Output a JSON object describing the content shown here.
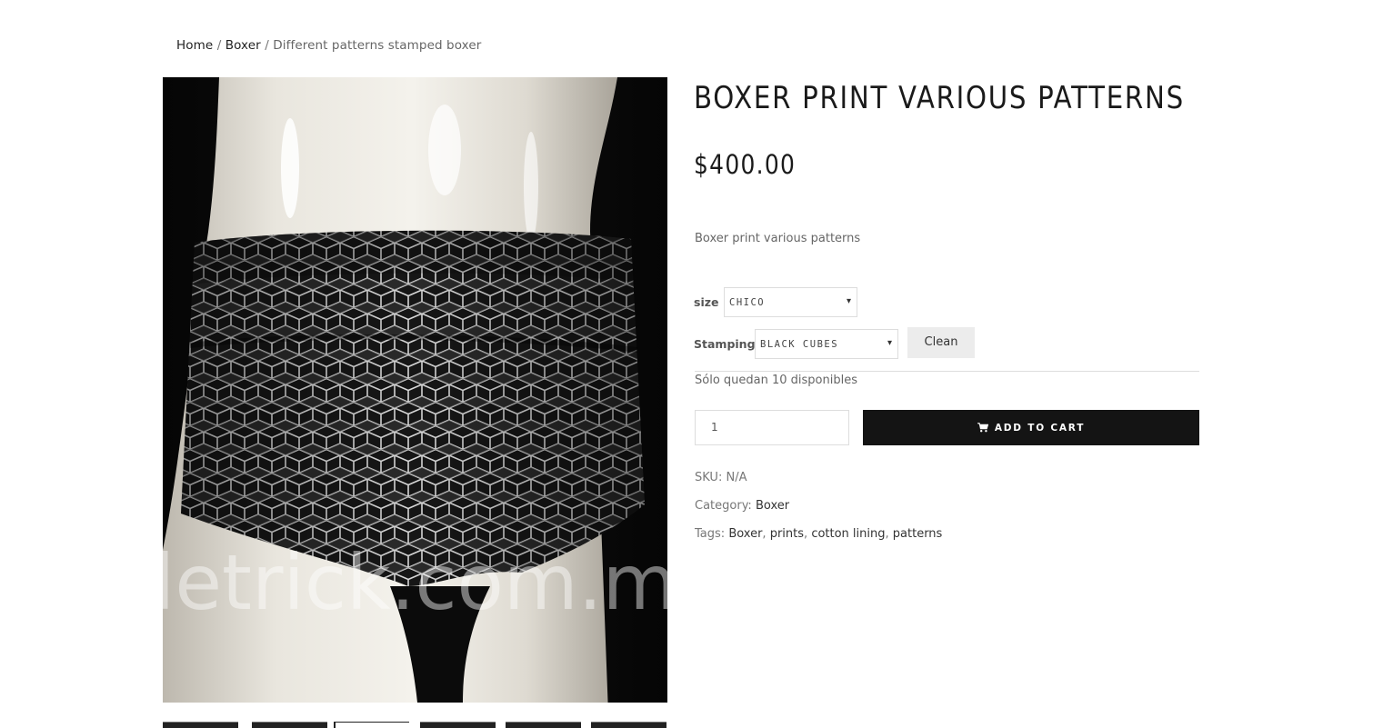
{
  "breadcrumb": {
    "home": "Home",
    "separator": "/",
    "category": "Boxer",
    "current": "Different patterns stamped boxer"
  },
  "gallery": {
    "watermark": "letrick.com.m",
    "thumbnail_count": 6
  },
  "product": {
    "title": "BOXER PRINT VARIOUS PATTERNS",
    "price": "$400.00",
    "short_description": "Boxer print various patterns"
  },
  "variations": {
    "size_label": "size",
    "size_value": "CHICO",
    "stamping_label": "Stamping",
    "stamping_value": "BLACK CUBES",
    "clean_label": "Clean"
  },
  "stock": "Sólo quedan 10 disponibles",
  "cart": {
    "quantity": "1",
    "button_label": "ADD TO CART"
  },
  "meta": {
    "sku_label": "SKU:",
    "sku_value": "N/A",
    "category_label": "Category:",
    "category_value": "Boxer",
    "tags_label": "Tags:",
    "tags": [
      "Boxer",
      "prints",
      "cotton lining",
      "patterns"
    ]
  },
  "colors": {
    "button_dark": "#141414",
    "clean_button_bg": "#ececec",
    "text_dark": "#1a1a1a"
  },
  "icons": {
    "cart": "cart-icon",
    "select_arrow": "chevron-down-icon"
  }
}
